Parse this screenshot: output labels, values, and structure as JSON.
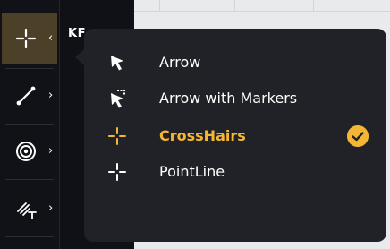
{
  "background_label": "KF",
  "toolbar": {
    "tools": [
      {
        "name": "crosshairs-tool",
        "icon": "crosshair-icon",
        "chevron": "‹"
      },
      {
        "name": "line-tool",
        "icon": "line-icon",
        "chevron": "›"
      },
      {
        "name": "shape-tool",
        "icon": "target-icon",
        "chevron": "›"
      },
      {
        "name": "text-tool",
        "icon": "pen-text-icon",
        "chevron": "›"
      }
    ]
  },
  "menu": {
    "items": [
      {
        "label": "Arrow",
        "icon": "arrow-cursor-icon",
        "selected": false
      },
      {
        "label": "Arrow with Markers",
        "icon": "arrow-markers-icon",
        "selected": false
      },
      {
        "label": "CrossHairs",
        "icon": "crosshair-icon",
        "selected": true
      },
      {
        "label": "PointLine",
        "icon": "crosshair-icon",
        "selected": false
      }
    ]
  },
  "colors": {
    "accent": "#f5b733",
    "menu_bg": "#202227",
    "toolbar_bg": "#101217",
    "active_tool_bg": "#4d4029"
  }
}
